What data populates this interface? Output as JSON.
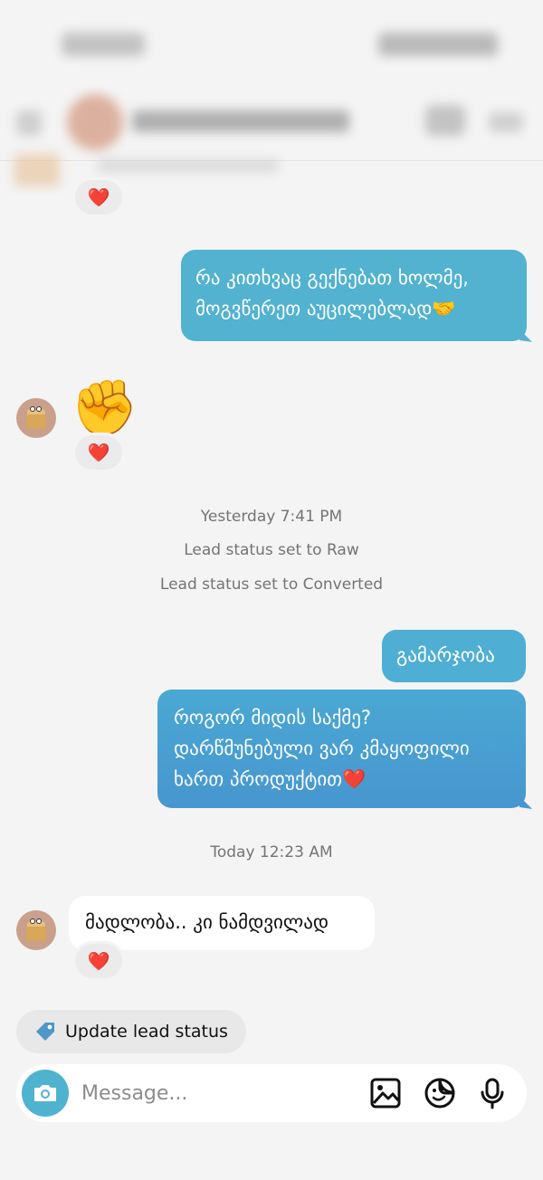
{
  "messages": {
    "out_1_line1": "რა კითხვაც გექნებათ ხოლმე,",
    "out_1_line2": "მოგვწერეთ აუცილებლად🤝",
    "reaction": "❤️",
    "fist_emoji": "✊",
    "note_time_1": "Yesterday 7:41 PM",
    "note_status_1": "Lead status set to Raw",
    "note_status_2": "Lead status set to Converted",
    "out_2": "გამარჯობა",
    "out_3_line1": "როგორ მიდის საქმე?",
    "out_3_line2": "დარწმუნებული ვარ კმაყოფილი",
    "out_3_line3": "ხართ პროდუქტით❤️",
    "note_time_2": "Today 12:23 AM",
    "in_1": "მადლობა.. კი ნამდვილად"
  },
  "chip": {
    "label": "Update lead status"
  },
  "composer": {
    "placeholder": "Message..."
  },
  "colors": {
    "bubble_light": "#52b2d0",
    "bubble_grad_top": "#4fb0d3",
    "bubble_grad_bottom": "#4796d0",
    "accent": "#4fb3cf",
    "reaction_heart": "#e2213b"
  },
  "icons": {
    "camera": "camera-icon",
    "gallery": "image-icon",
    "sticker": "sticker-icon",
    "mic": "microphone-icon",
    "tag": "tag-icon"
  }
}
